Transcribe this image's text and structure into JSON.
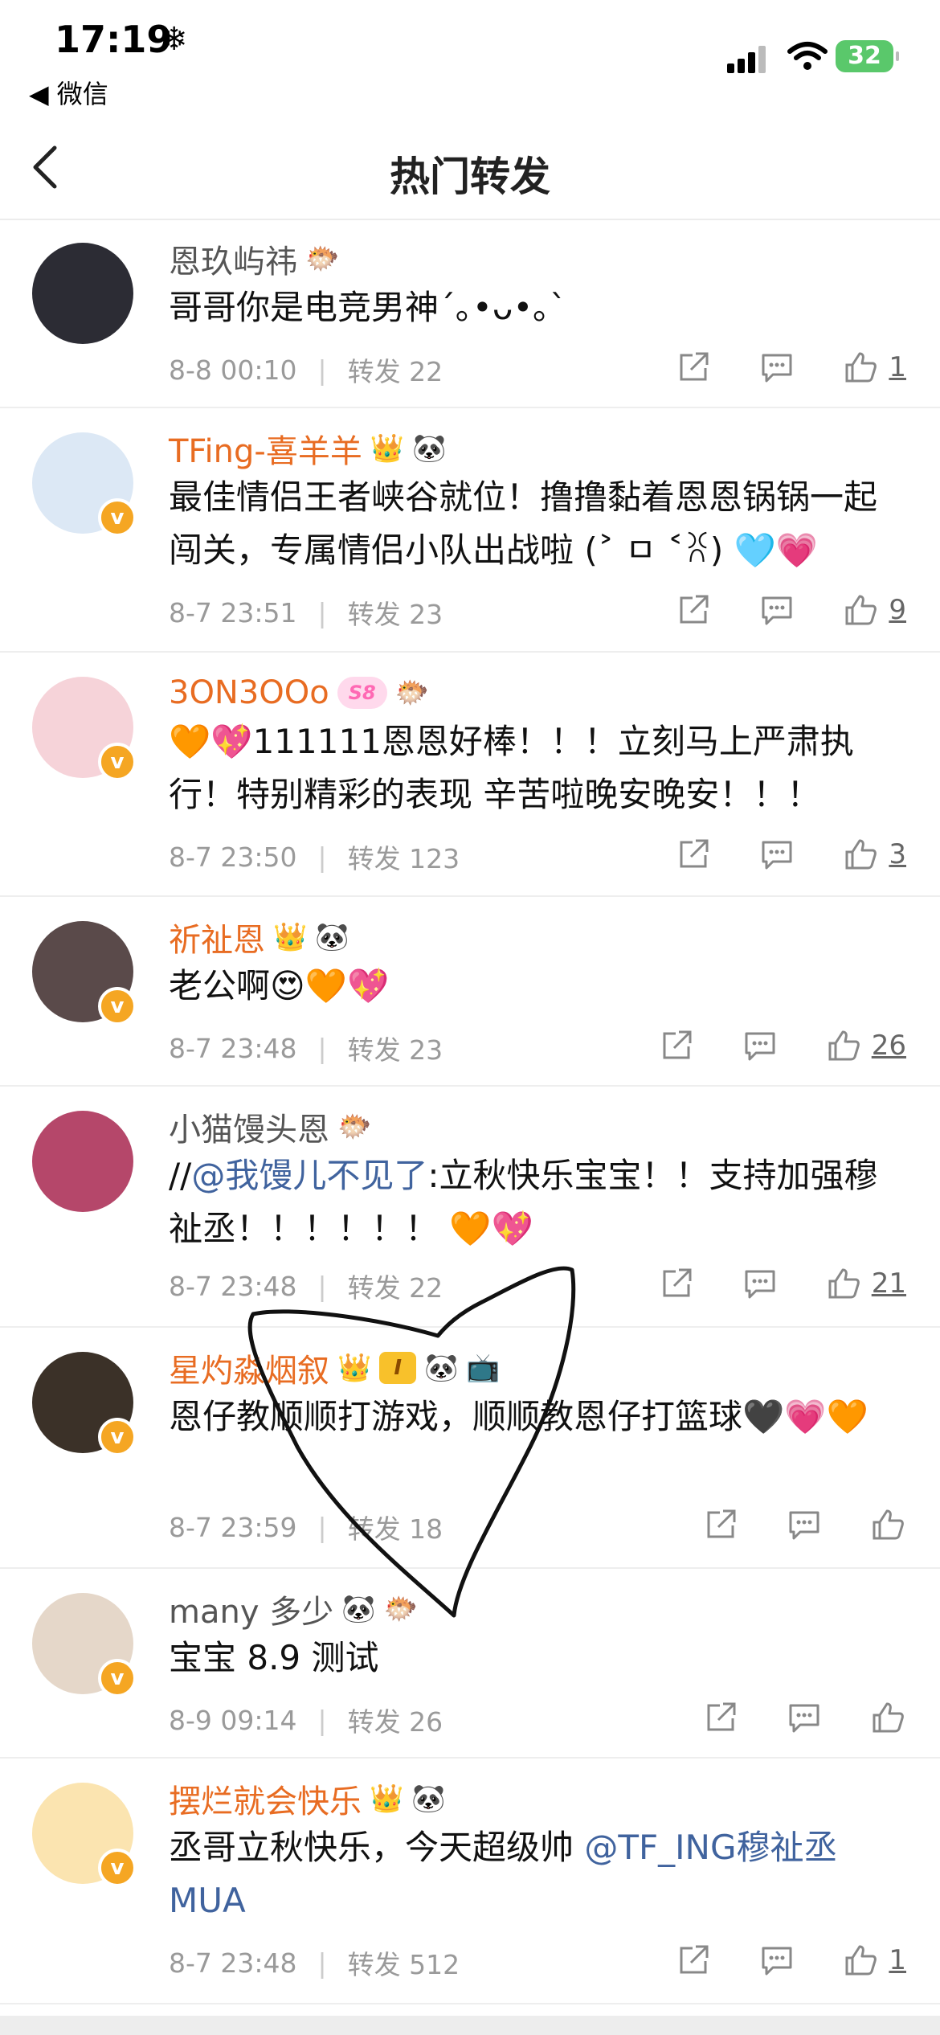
{
  "status_bar": {
    "time": "17:19",
    "weather_icon": "snowflake-icon",
    "back_app": "◀ 微信",
    "battery": "32"
  },
  "nav": {
    "title": "热门转发",
    "back_icon": "chevron-left-icon"
  },
  "items": [
    {
      "username": "恩玖屿祎",
      "name_style": "gray",
      "badges": [
        "🐡"
      ],
      "content_parts": [
        {
          "text": "哥哥你是电竞男神ˊ｡•ᴗ•｡ˋ",
          "mention": false
        }
      ],
      "date": "8-8 00:10",
      "forward": "转发 22",
      "likes": "1",
      "verified": false,
      "avatar_color": "#2c2c34"
    },
    {
      "username": "TFing-喜羊羊",
      "name_style": "orange",
      "badges": [
        "👑",
        "🐼"
      ],
      "content_parts": [
        {
          "text": "最佳情侣王者峡谷就位！撸撸黏着恩恩锅锅一起闯关，专属情侣小队出战啦 (˃ ㅁ ˂ꐦ) 🩵💗",
          "mention": false
        }
      ],
      "date": "8-7 23:51",
      "forward": "转发 23",
      "likes": "9",
      "verified": true,
      "avatar_color": "#dce8f5"
    },
    {
      "username": "3ON3OOo",
      "name_style": "orange",
      "badges": [
        "🐡"
      ],
      "vip": "S8",
      "content_parts": [
        {
          "text": "🧡💖111111恩恩好棒！！！立刻马上严肃执行！特别精彩的表现 辛苦啦晚安晚安！！！",
          "mention": false
        }
      ],
      "date": "8-7 23:50",
      "forward": "转发 123",
      "likes": "3",
      "verified": true,
      "avatar_color": "#f6d3d9"
    },
    {
      "username": "祈祉恩",
      "name_style": "orange",
      "badges": [
        "👑",
        "🐼"
      ],
      "content_parts": [
        {
          "text": "老公啊😍🧡💖",
          "mention": false
        }
      ],
      "date": "8-7 23:48",
      "forward": "转发 23",
      "likes": "26",
      "verified": true,
      "avatar_color": "#5a4a4a"
    },
    {
      "username": "小猫馒头恩",
      "name_style": "gray",
      "badges": [
        "🐡"
      ],
      "content_parts": [
        {
          "text": "//",
          "mention": false
        },
        {
          "text": "@我馒儿不见了",
          "mention": true
        },
        {
          "text": ":立秋快乐宝宝！！支持加强穆祉丞！！！！！！ 🧡💖",
          "mention": false
        }
      ],
      "date": "8-7 23:48",
      "forward": "转发 22",
      "likes": "21",
      "verified": false,
      "avatar_color": "#b5476a"
    },
    {
      "username": "星灼淼烟叙",
      "name_style": "orange",
      "badges": [
        "🐼",
        "📺"
      ],
      "level": "I",
      "content_parts": [
        {
          "text": "恩仔教顺顺打游戏，顺顺教恩仔打篮球🖤💗🧡",
          "mention": false
        }
      ],
      "date": "8-7 23:59",
      "forward": "转发 18",
      "likes": "",
      "verified": true,
      "avatar_color": "#3b3128"
    },
    {
      "username": "many 多少",
      "name_style": "gray",
      "badges": [
        "🐼",
        "🐡"
      ],
      "content_parts": [
        {
          "text": "宝宝 8.9 测试",
          "mention": false
        }
      ],
      "date": "8-9 09:14",
      "forward": "转发 26",
      "likes": "",
      "verified": true,
      "avatar_color": "#e5d7c9"
    },
    {
      "username": "摆烂就会快乐",
      "name_style": "orange",
      "badges": [
        "👑",
        "🐼"
      ],
      "content_parts": [
        {
          "text": "丞哥立秋快乐，今天超级帅 ",
          "mention": false
        },
        {
          "text": "@TF_ING穆祉丞 MUA",
          "mention": true
        }
      ],
      "date": "8-7 23:48",
      "forward": "转发 512",
      "likes": "1",
      "verified": true,
      "avatar_color": "#fbe4b0"
    }
  ],
  "colors": {
    "orange_name": "#e86c22",
    "mention": "#40639e",
    "meta_gray": "#9a9a9a",
    "vip_badge": "#f5a623"
  }
}
